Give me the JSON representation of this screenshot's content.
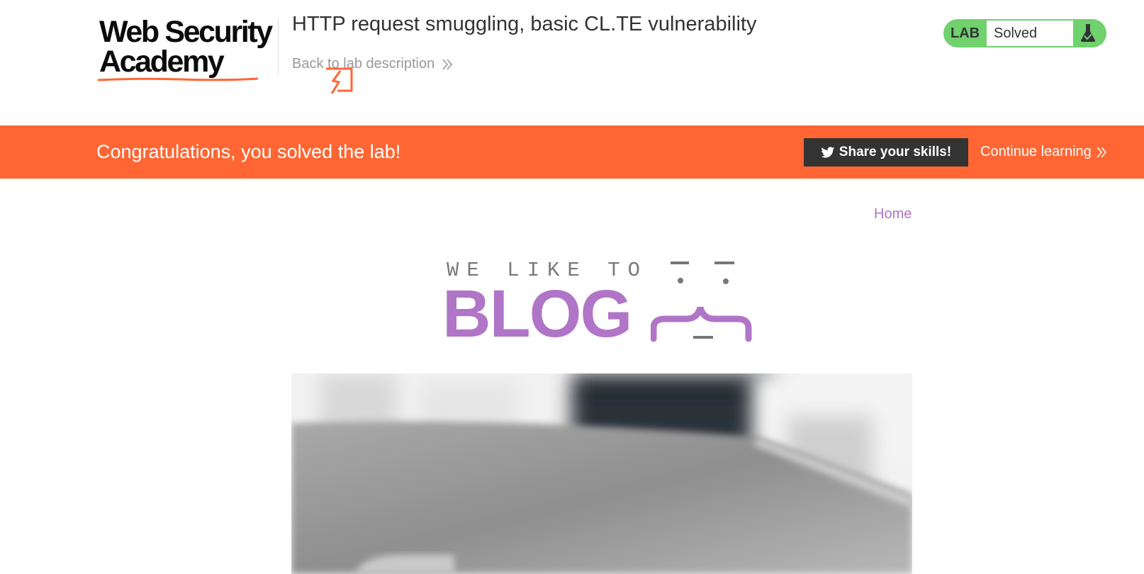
{
  "header": {
    "brand_line1": "Web Security",
    "brand_line2": "Academy",
    "lab_title": "HTTP request smuggling, basic CL.TE vulnerability",
    "back_link": "Back to lab description",
    "lab_badge_label": "LAB",
    "lab_status": "Solved"
  },
  "banner": {
    "message": "Congratulations, you solved the lab!",
    "share_label": "Share your skills!",
    "continue_label": "Continue learning"
  },
  "nav": {
    "home": "Home"
  },
  "blog_logo": {
    "tagline": "WE LIKE TO",
    "word": "BLOG"
  },
  "colors": {
    "banner_bg": "#ff6633",
    "badge_green": "#70d16d",
    "blog_purple": "#b075c7",
    "share_button_bg": "#333333"
  },
  "icons": [
    "wsa-logo-mark",
    "chevron-double-right-icon",
    "flask-icon",
    "twitter-icon",
    "blog-face-icon"
  ]
}
